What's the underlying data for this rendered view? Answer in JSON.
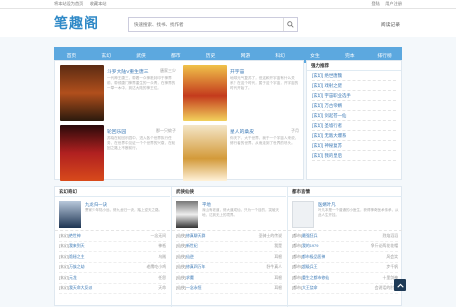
{
  "top": {
    "left": [
      "将本站设为首页",
      "收藏本站"
    ],
    "right": [
      "登陆",
      "用户注册"
    ]
  },
  "logo": "笔趣阁",
  "search": {
    "placeholder": "快速搜索、找书、找作者"
  },
  "history": "阅读记录",
  "nav": [
    "首页",
    "玄幻",
    "武侠",
    "都市",
    "历史",
    "网游",
    "科幻",
    "女生",
    "完本",
    "排行榜"
  ],
  "featured": [
    {
      "title": "斗罗大陆V重生唐三",
      "author": "唐家三少",
      "desc": "一代神王唐三，带着一众神祇封印于神界前，带领唐门神界重生的一众青，在神界的一草一木中，到达大陆的神王位。"
    },
    {
      "title": "开宇宙",
      "author": "",
      "desc": "地球元气复苏了，但这和开宇宙有什么关系？在这个时代，属于这个宇宙，开宇宙的时代开始了。"
    },
    {
      "title": "轮回乐园",
      "author": "那一只蚊子",
      "desc": "苏晓在轮回乐园中，进入各个世界执行任务，在世界中见证一个个世界的兴衰，在轮回之路上不断前行。"
    },
    {
      "title": "星人的桑皮",
      "author": "子月",
      "desc": "你天下，大千世界，我于一个宇宙人来说，修行者的世界，从而走到了世界的尽头。"
    }
  ],
  "ranking": {
    "title": "强力推荐",
    "items": [
      "[玄幻] 绝世唐魏",
      "[玄幻] 戏射之佬",
      "[玄幻] 宇宙职业选手",
      "[玄幻] 万古帝婿",
      "[玄幻] 剑起苍一仙",
      "[玄幻] 圣墟行者",
      "[玄幻] 无敌大爆系",
      "[玄幻] 神秘复苏",
      "[玄幻] 我的皇后"
    ]
  },
  "columns": [
    {
      "title": "玄幻奇幻",
      "feat": {
        "title": "九龙归一诀",
        "desc": "萧家少年陆小远，修九龙归一诀，踏上逆天之路。"
      },
      "rows": [
        {
          "c": "[玄幻]",
          "t": "绝世神",
          "a": "一念无间"
        },
        {
          "c": "[玄幻]",
          "t": "我来到天",
          "a": "神祇"
        },
        {
          "c": "[玄幻]",
          "t": "诡秘之主",
          "a": "乌贼"
        },
        {
          "c": "[玄幻]",
          "t": "万族之劫",
          "a": "老鹰吃小鸡"
        },
        {
          "c": "[玄幻]",
          "t": "元龙",
          "a": "任怨"
        },
        {
          "c": "[玄幻]",
          "t": "我天命大反派",
          "a": "天命"
        }
      ]
    },
    {
      "title": "武侠仙侠",
      "feat": {
        "title": "平地",
        "desc": "深山有老道，修大道成仙，只为一个目的，突破天地，达到无上的境界。"
      },
      "rows": [
        {
          "c": "[仙侠]",
          "t": "修真聊天群",
          "a": "圣骑士的传说"
        },
        {
          "c": "[仙侠]",
          "t": "新世纪",
          "a": "我是"
        },
        {
          "c": "[仙侠]",
          "t": "仙逆",
          "a": "耳根"
        },
        {
          "c": "[仙侠]",
          "t": "修真四万年",
          "a": "卧牛真人"
        },
        {
          "c": "[仙侠]",
          "t": "求魔",
          "a": "耳根"
        },
        {
          "c": "[仙侠]",
          "t": "一念永恒",
          "a": "耳根"
        }
      ]
    },
    {
      "title": "都市言情",
      "feat": {
        "title": "医婿叶凡",
        "desc": "叶凡本是一个普通的小医生，获得神奇医术传承，从此人生开挂。"
      },
      "rows": [
        {
          "c": "[都市]",
          "t": "最强狂兵",
          "a": "烈焰滔滔"
        },
        {
          "c": "[都市]",
          "t": "我的1979",
          "a": "争斤论两花花帽"
        },
        {
          "c": "[都市]",
          "t": "都市极品医神",
          "a": "风会笑"
        },
        {
          "c": "[都市]",
          "t": "超级兵王",
          "a": "步千帆"
        },
        {
          "c": "[都市]",
          "t": "重生之都市修仙",
          "a": "十里剑神"
        },
        {
          "c": "[都市]",
          "t": "大王饶命",
          "a": "会说话的肘子"
        }
      ]
    }
  ]
}
